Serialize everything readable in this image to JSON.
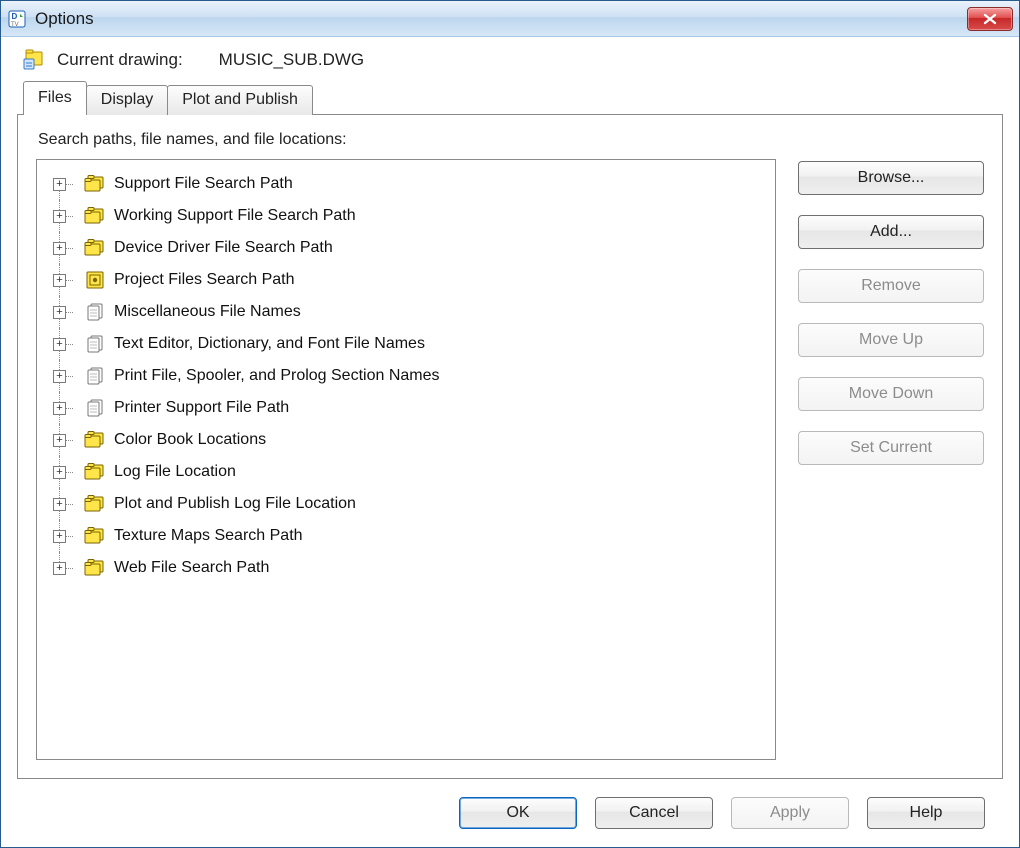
{
  "window": {
    "title": "Options"
  },
  "header": {
    "current_drawing_label": "Current drawing:",
    "current_drawing_value": "MUSIC_SUB.DWG"
  },
  "tabs": [
    {
      "label": "Files",
      "active": true
    },
    {
      "label": "Display",
      "active": false
    },
    {
      "label": "Plot and Publish",
      "active": false
    }
  ],
  "section_label": "Search paths, file names, and file locations:",
  "tree": [
    {
      "label": "Support File Search Path",
      "icon": "folder-stack"
    },
    {
      "label": "Working Support File Search Path",
      "icon": "folder-stack"
    },
    {
      "label": "Device Driver File Search Path",
      "icon": "folder-stack"
    },
    {
      "label": "Project Files Search Path",
      "icon": "box"
    },
    {
      "label": "Miscellaneous File Names",
      "icon": "sheet"
    },
    {
      "label": "Text Editor, Dictionary, and Font File Names",
      "icon": "sheet"
    },
    {
      "label": "Print File, Spooler, and Prolog Section Names",
      "icon": "sheet"
    },
    {
      "label": "Printer Support File Path",
      "icon": "sheet"
    },
    {
      "label": "Color Book Locations",
      "icon": "folder-stack"
    },
    {
      "label": "Log File Location",
      "icon": "folder-stack"
    },
    {
      "label": "Plot and Publish Log File Location",
      "icon": "folder-stack"
    },
    {
      "label": "Texture Maps Search Path",
      "icon": "folder-stack"
    },
    {
      "label": "Web File Search Path",
      "icon": "folder-stack"
    }
  ],
  "side_buttons": [
    {
      "label": "Browse...",
      "enabled": true
    },
    {
      "label": "Add...",
      "enabled": true
    },
    {
      "label": "Remove",
      "enabled": false
    },
    {
      "label": "Move Up",
      "enabled": false
    },
    {
      "label": "Move Down",
      "enabled": false
    },
    {
      "label": "Set Current",
      "enabled": false
    }
  ],
  "bottom_buttons": {
    "ok": "OK",
    "cancel": "Cancel",
    "apply": "Apply",
    "help": "Help"
  }
}
